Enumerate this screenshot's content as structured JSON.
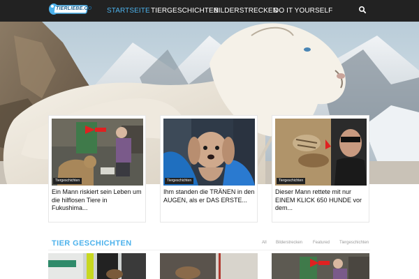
{
  "brand": {
    "logo_text": "TIERLIEBE.CO",
    "accent": "#4db2ec"
  },
  "nav": {
    "items": [
      {
        "label": "STARTSEITE",
        "active": true
      },
      {
        "label": "TIERGESCHICHTEN",
        "active": false
      },
      {
        "label": "BILDERSTRECKEN",
        "active": false
      },
      {
        "label": "DO IT YOURSELF",
        "active": false
      }
    ],
    "search_icon": "search-icon"
  },
  "featured": [
    {
      "category": "Tiergeschichten",
      "title": "Ein Mann riskiert sein Leben um die hilflosen Tiere in Fukushima..."
    },
    {
      "category": "Tiergeschichten",
      "title": "Ihm standen die TRÄNEN in den AUGEN, als er DAS ERSTE..."
    },
    {
      "category": "Tiergeschichten",
      "title": "Dieser Mann rettete mit nur EINEM KLICK 650 HUNDE vor dem..."
    }
  ],
  "section": {
    "title": "TIER GESCHICHTEN",
    "filters": [
      "All",
      "Bilderstrecken",
      "Featured",
      "Tiergeschichten"
    ]
  }
}
